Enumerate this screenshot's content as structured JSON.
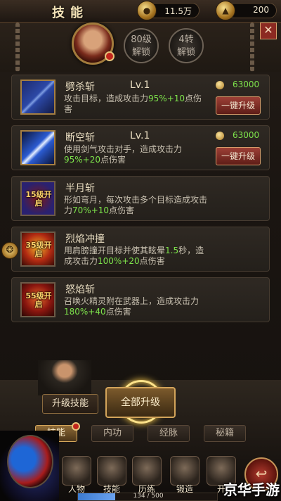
{
  "header": {
    "title": "技能",
    "gold": "11.5万",
    "ingot": "200",
    "unlock_level": [
      "80级",
      "解锁"
    ],
    "unlock_rebirth": [
      "4转",
      "解锁"
    ]
  },
  "skills": [
    {
      "name": "劈杀斩",
      "level": "Lv.1",
      "desc_a": "攻击目标，造成攻击力",
      "desc_hl": "95%+10",
      "desc_b": "点伤害",
      "cost": "63000",
      "button": "一键升级"
    },
    {
      "name": "断空斩",
      "level": "Lv.1",
      "desc_a": "使用剑气攻击对手，造成攻击力",
      "desc_hl": "95%+20",
      "desc_b": "点伤害",
      "cost": "63000",
      "button": "一键升级"
    },
    {
      "name": "半月斩",
      "lock_tag": "15级开启",
      "desc_a": "形如弯月，每次攻击多个目标造成攻击力",
      "desc_hl": "70%+10",
      "desc_b": "点伤害"
    },
    {
      "name": "烈焰冲撞",
      "lock_tag": "35级开启",
      "desc_a": "用肩膀撞开目标并使其眩晕",
      "desc_hl1": "1.5",
      "desc_mid": "秒，造成攻击力",
      "desc_hl2": "100%+20",
      "desc_b": "点伤害"
    },
    {
      "name": "怒焰斩",
      "lock_tag": "55级开启",
      "desc_a": "召唤火精灵附在武器上，造成攻击力",
      "desc_hl": "180%+40",
      "desc_b": "点伤害"
    }
  ],
  "actions": {
    "upgrade_skill": "升级技能",
    "upgrade_all": "全部升级"
  },
  "tabs": [
    "技能",
    "内功",
    "经脉",
    "秘籍"
  ],
  "nav": [
    "人物",
    "技能",
    "历练",
    "锻造",
    "开"
  ],
  "exp": {
    "text": "134 / 500",
    "fraction": 0.268
  },
  "watermark": "京华手游",
  "colors": {
    "highlight": "#7de24b",
    "accent_gold": "#d3a45a",
    "button_red": "#9d4036"
  }
}
